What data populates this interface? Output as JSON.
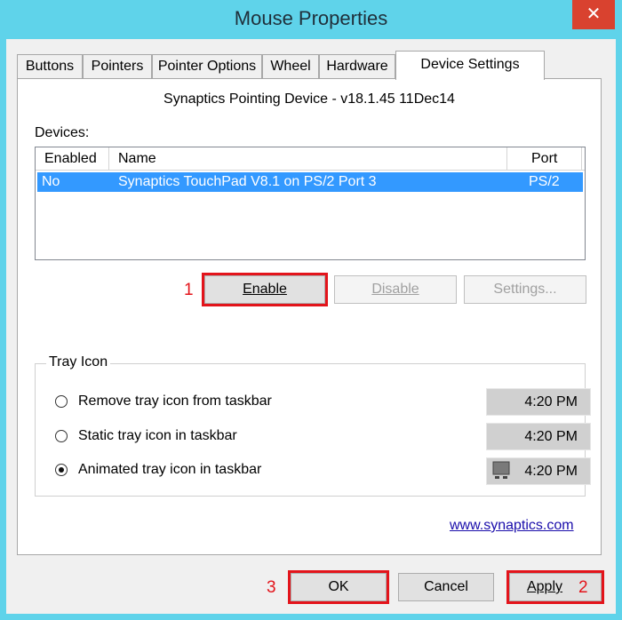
{
  "window": {
    "title": "Mouse Properties",
    "close_glyph": "✕"
  },
  "tabs": [
    {
      "label": "Buttons"
    },
    {
      "label": "Pointers"
    },
    {
      "label": "Pointer Options"
    },
    {
      "label": "Wheel"
    },
    {
      "label": "Hardware"
    },
    {
      "label": "Device Settings"
    }
  ],
  "panel": {
    "device_heading": "Synaptics Pointing Device - v18.1.45 11Dec14",
    "devices_label": "Devices:"
  },
  "devices_list": {
    "columns": [
      "Enabled",
      "Name",
      "Port"
    ],
    "rows": [
      {
        "enabled": "No",
        "name": "Synaptics TouchPad V8.1 on PS/2 Port 3",
        "port": "PS/2"
      }
    ]
  },
  "device_buttons": {
    "enable": "Enable",
    "disable": "Disable",
    "settings": "Settings..."
  },
  "tray_icon": {
    "group_label": "Tray Icon",
    "options": [
      {
        "label": "Remove tray icon from taskbar",
        "time": "4:20 PM",
        "checked": false
      },
      {
        "label": "Static tray icon in taskbar",
        "time": "4:20 PM",
        "checked": false
      },
      {
        "label": "Animated tray icon in taskbar",
        "time": "4:20 PM",
        "checked": true
      }
    ]
  },
  "link": "www.synaptics.com",
  "footer": {
    "ok": "OK",
    "cancel": "Cancel",
    "apply": "Apply"
  },
  "annotations": {
    "step1": "1",
    "step2": "2",
    "step3": "3"
  },
  "colors": {
    "highlight": "#e3141b",
    "selection": "#3399ff",
    "frame": "#5fd3ea",
    "close": "#d9422f"
  }
}
